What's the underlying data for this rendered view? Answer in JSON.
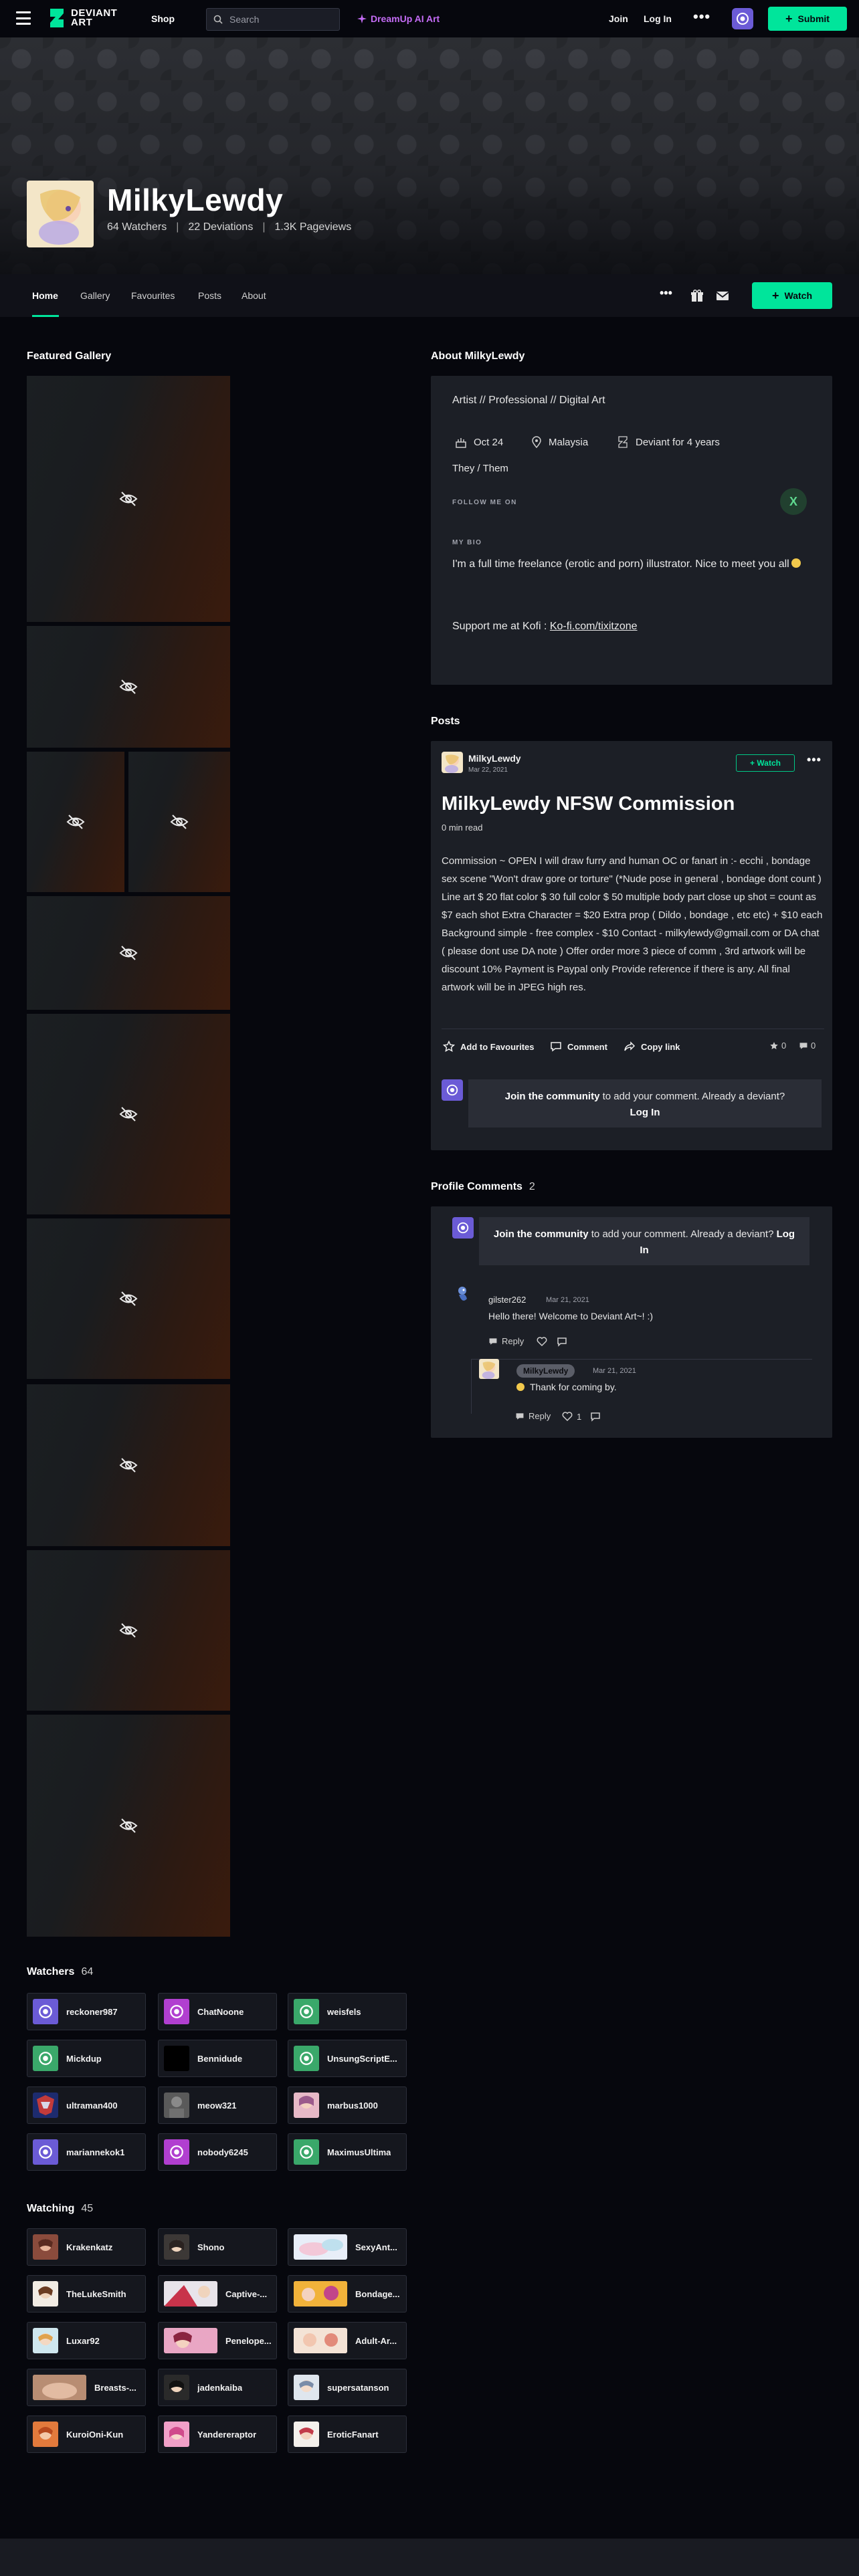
{
  "topbar": {
    "logo_line1": "DEVIANT",
    "logo_line2": "ART",
    "shop": "Shop",
    "search_placeholder": "Search",
    "dreamup": "DreamUp AI Art",
    "join": "Join",
    "login": "Log In",
    "more": "•••",
    "submit": "Submit"
  },
  "profile": {
    "name": "MilkyLewdy",
    "watchers": "64 Watchers",
    "deviations": "22 Deviations",
    "pageviews": "1.3K Pageviews",
    "separator": "|"
  },
  "profile_nav": {
    "tabs": [
      "Home",
      "Gallery",
      "Favourites",
      "Posts",
      "About"
    ],
    "active_tab": "Home",
    "more": "•••",
    "watch": "Watch"
  },
  "featured": {
    "title": "Featured Gallery"
  },
  "about": {
    "title": "About MilkyLewdy",
    "roles": "Artist  //  Professional  //  Digital Art",
    "birthday": "Oct 24",
    "location": "Malaysia",
    "member": "Deviant for 4 years",
    "pronouns": "They / Them",
    "follow_label": "FOLLOW ME ON",
    "follow_icon": "X",
    "bio_label": "MY BIO",
    "bio": "I'm a full time freelance (erotic and porn) illustrator. Nice to meet you all",
    "support_prefix": "Support me at Kofi : ",
    "support_link": "Ko-fi.com/tixitzone"
  },
  "posts": {
    "title": "Posts",
    "author": "MilkyLewdy",
    "date": "Mar 22, 2021",
    "watch": "+ Watch",
    "more": "•••",
    "post_title": "MilkyLewdy NFSW Commission",
    "read_time": "0 min read",
    "body": "Commission ~ OPEN I will draw furry and human OC or fanart in :- ecchi , bondage sex scene \"Won't draw gore or torture\" (*Nude pose in general , bondage dont count ) Line art $ 20 flat color $ 30 full color $ 50 multiple body part close up shot = count as $7 each shot Extra Character = $20 Extra prop ( Dildo , bondage , etc etc) + $10 each Background simple - free complex - $10 Contact - milkylewdy@gmail.com or DA chat ( please dont use DA note ) Offer order more 3 piece of comm , 3rd artwork will be discount 10% Payment is Paypal only Provide reference if there is any. All final artwork will be in JPEG high res.",
    "add_fav": "Add to Favourites",
    "comment": "Comment",
    "copy_link": "Copy link",
    "fav_count": "0",
    "comment_count": "0",
    "join_bold": "Join the community",
    "join_rest": " to add your comment. Already a deviant? ",
    "join_login": "Log In"
  },
  "profile_comments": {
    "title": "Profile Comments",
    "count": "2",
    "join_bold": "Join the community",
    "join_rest": " to add your comment. Already a deviant? ",
    "join_login": "Log In",
    "comments": [
      {
        "user": "gilster262",
        "date": "Mar 21, 2021",
        "text": "Hello there! Welcome to Deviant Art~! :)",
        "reply": "Reply"
      },
      {
        "user": "MilkyLewdy",
        "date": "Mar 21, 2021",
        "text": "Thank for coming by.",
        "reply": "Reply",
        "likes": "1"
      }
    ]
  },
  "watchers": {
    "title": "Watchers",
    "count": "64",
    "users": [
      "reckoner987",
      "ChatNoone",
      "weisfels",
      "Mickdup",
      "Bennidude",
      "UnsungScriptE...",
      "ultraman400",
      "meow321",
      "marbus1000",
      "mariannekok1",
      "nobody6245",
      "MaximusUltima"
    ]
  },
  "watching": {
    "title": "Watching",
    "count": "45",
    "users": [
      "Krakenkatz",
      "Shono",
      "SexyAnt...",
      "TheLukeSmith",
      "Captive-...",
      "Bondage...",
      "Luxar92",
      "Penelope...",
      "Adult-Ar...",
      "Breasts-...",
      "jadenkaiba",
      "supersatanson",
      "KuroiOni-Kun",
      "Yandereraptor",
      "EroticFanart"
    ]
  },
  "colors": {
    "accent": "#00e59b",
    "dreamup": "#c46cf5",
    "background": "#06070d",
    "panel": "#1c1f26",
    "default_avatar": "#6b5bd6"
  }
}
